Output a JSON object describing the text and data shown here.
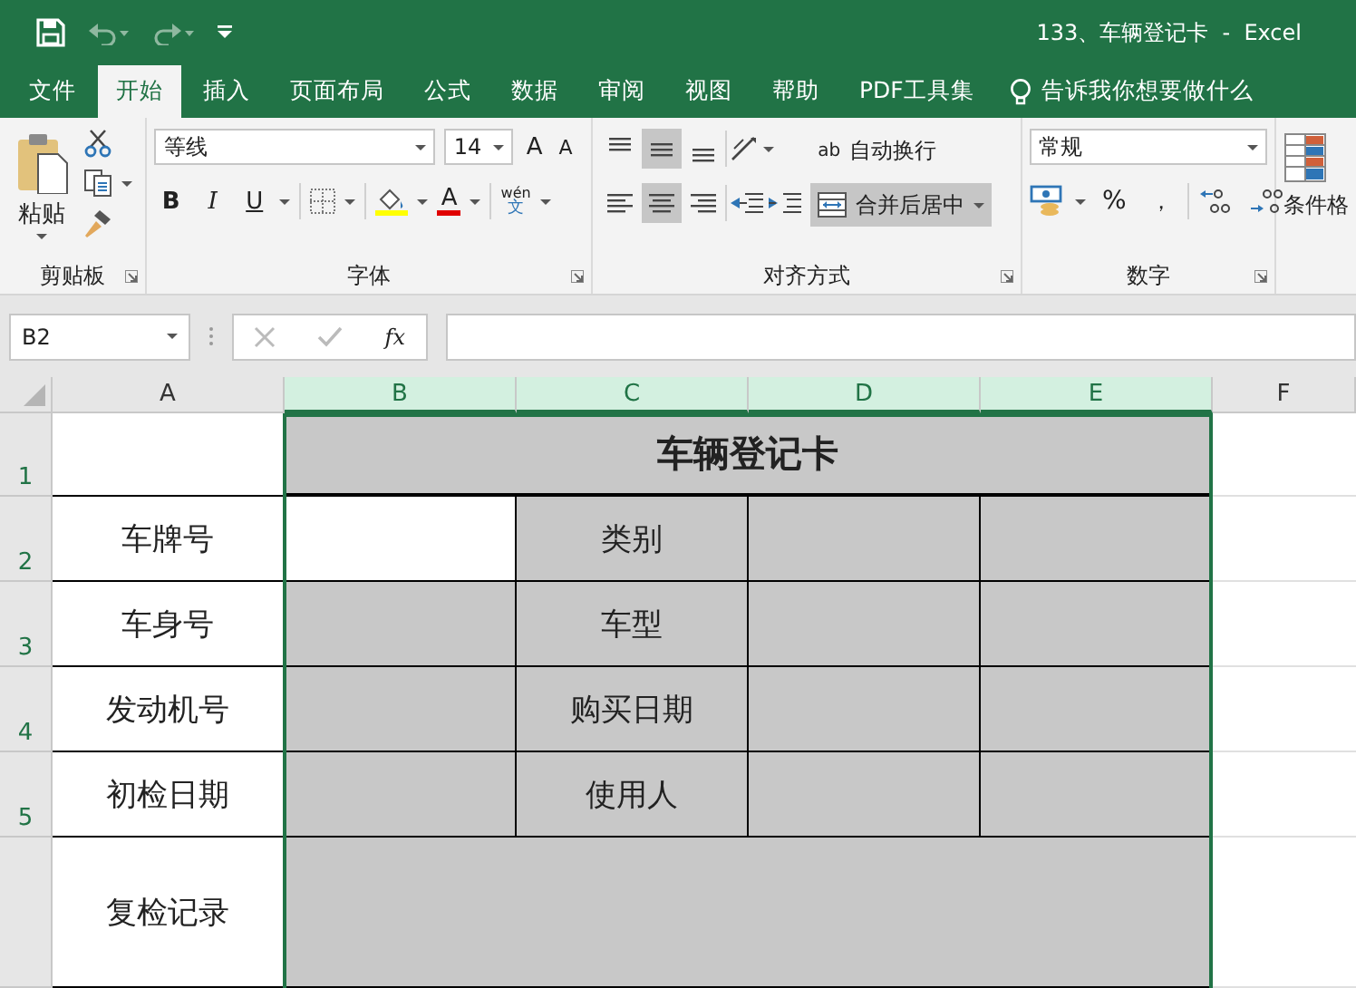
{
  "window": {
    "title": "133、车辆登记卡  -  Excel"
  },
  "tabs": [
    {
      "label": "文件",
      "selected": false
    },
    {
      "label": "开始",
      "selected": true
    },
    {
      "label": "插入",
      "selected": false
    },
    {
      "label": "页面布局",
      "selected": false
    },
    {
      "label": "公式",
      "selected": false
    },
    {
      "label": "数据",
      "selected": false
    },
    {
      "label": "审阅",
      "selected": false
    },
    {
      "label": "视图",
      "selected": false
    },
    {
      "label": "帮助",
      "selected": false
    },
    {
      "label": "PDF工具集",
      "selected": false
    }
  ],
  "tell_me": "告诉我你想要做什么",
  "ribbon": {
    "clipboard": {
      "paste": "粘贴",
      "label": "剪贴板"
    },
    "font": {
      "name": "等线",
      "size": "14",
      "grow": "A",
      "shrink": "A",
      "bold": "B",
      "italic": "I",
      "underline": "U",
      "font_color": "A",
      "phonetic_top": "wén",
      "phonetic_bottom": "文",
      "label": "字体"
    },
    "alignment": {
      "wrap_icon": "ab",
      "wrap": "自动换行",
      "merge": "合并后居中",
      "merge_selected": true,
      "label": "对齐方式"
    },
    "number": {
      "format": "常规",
      "percent": "%",
      "comma": "，",
      "label": "数字"
    },
    "styles": {
      "conditional": "条件格"
    }
  },
  "name_box": "B2",
  "fx": "fx",
  "columns": [
    {
      "label": "A",
      "selected": false
    },
    {
      "label": "B",
      "selected": true
    },
    {
      "label": "C",
      "selected": true
    },
    {
      "label": "D",
      "selected": true
    },
    {
      "label": "E",
      "selected": true
    },
    {
      "label": "F",
      "selected": false
    }
  ],
  "rows": [
    {
      "header": "1",
      "selected": true,
      "cells": [
        {
          "kind": "cell",
          "shaded": false
        },
        {
          "kind": "title",
          "text": "车辆登记卡",
          "shaded": true
        }
      ]
    },
    {
      "header": "2",
      "selected": true,
      "cells": [
        {
          "kind": "cell",
          "text": "车牌号",
          "shaded": false
        },
        {
          "kind": "cell",
          "shaded": false
        },
        {
          "kind": "cell",
          "text": "类别",
          "shaded": true
        },
        {
          "kind": "cell",
          "shaded": true
        },
        {
          "kind": "cell",
          "shaded": true
        }
      ]
    },
    {
      "header": "3",
      "selected": true,
      "cells": [
        {
          "kind": "cell",
          "text": "车身号",
          "shaded": false
        },
        {
          "kind": "cell",
          "shaded": true
        },
        {
          "kind": "cell",
          "text": "车型",
          "shaded": true
        },
        {
          "kind": "cell",
          "shaded": true
        },
        {
          "kind": "cell",
          "shaded": true
        }
      ]
    },
    {
      "header": "4",
      "selected": true,
      "cells": [
        {
          "kind": "cell",
          "text": "发动机号",
          "shaded": false
        },
        {
          "kind": "cell",
          "shaded": true
        },
        {
          "kind": "cell",
          "text": "购买日期",
          "shaded": true
        },
        {
          "kind": "cell",
          "shaded": true
        },
        {
          "kind": "cell",
          "shaded": true
        }
      ]
    },
    {
      "header": "5",
      "selected": true,
      "cells": [
        {
          "kind": "cell",
          "text": "初检日期",
          "shaded": false
        },
        {
          "kind": "cell",
          "shaded": true
        },
        {
          "kind": "cell",
          "text": "使用人",
          "shaded": true
        },
        {
          "kind": "cell",
          "shaded": true
        },
        {
          "kind": "cell",
          "shaded": true
        }
      ]
    },
    {
      "cells": [
        {
          "kind": "cell",
          "text": "复检记录",
          "shaded": false
        },
        {
          "kind": "wide",
          "shaded": true
        }
      ]
    }
  ]
}
